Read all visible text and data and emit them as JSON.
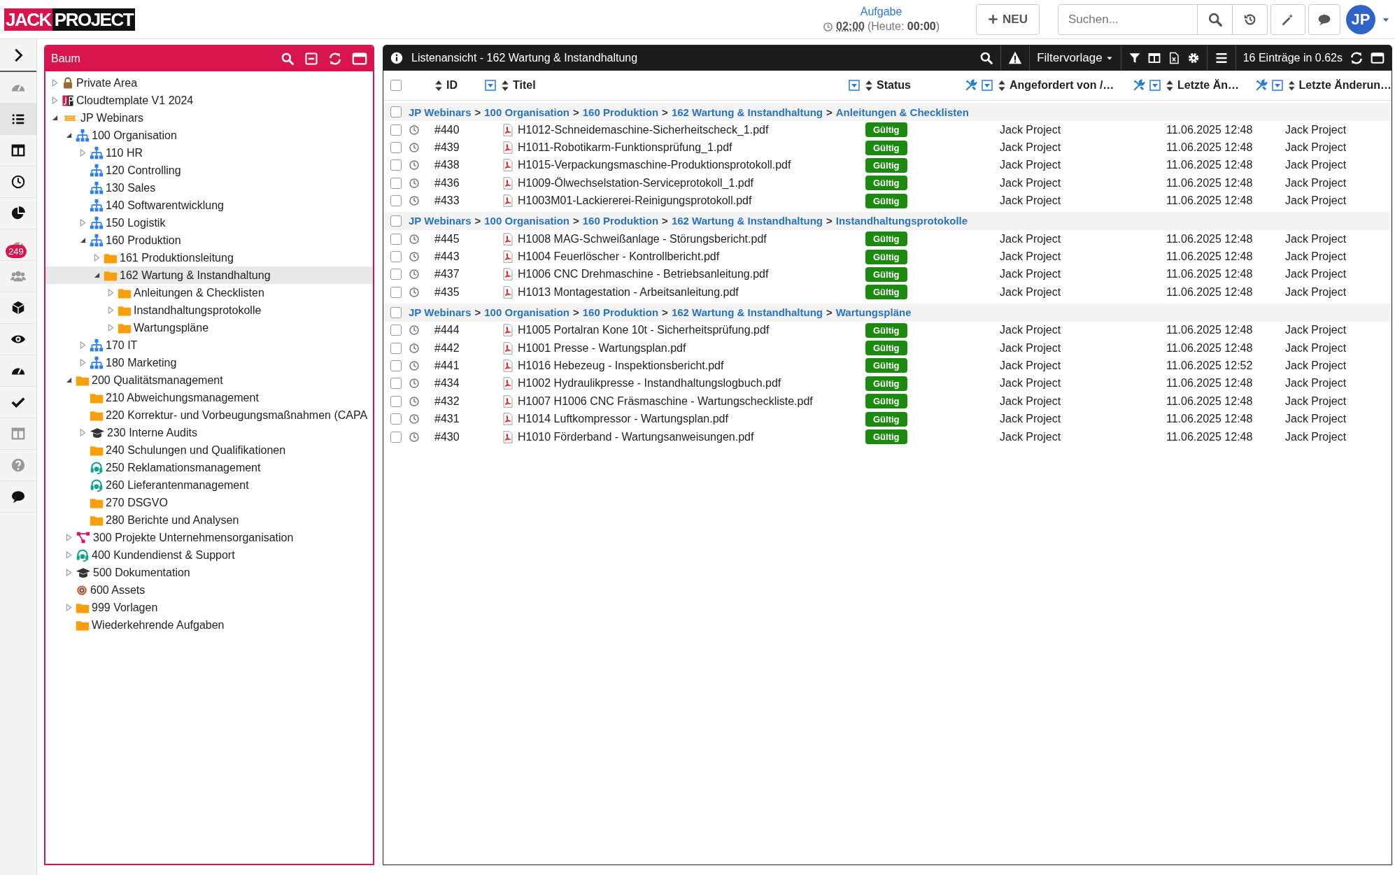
{
  "logo": [
    "JACK",
    "PROJECT"
  ],
  "task": {
    "label": "Aufgabe",
    "time": "02:00",
    "today": "(Heute: **00:00**)"
  },
  "topbar": {
    "new_button": "NEU",
    "search": {
      "placeholder": "Suchen..."
    },
    "avatar": "JP"
  },
  "rail": [
    {
      "kind": "expand",
      "selected": false,
      "dimmed": false
    },
    {
      "kind": "gauge",
      "selected": false,
      "dimmed": true
    },
    {
      "kind": "list",
      "selected": true,
      "dimmed": false
    },
    {
      "kind": "columns",
      "selected": false,
      "dimmed": false
    },
    {
      "kind": "clock",
      "selected": false,
      "dimmed": false
    },
    {
      "kind": "pie",
      "selected": false,
      "dimmed": false
    },
    {
      "kind": "gauge",
      "selected": false,
      "dimmed": true,
      "badge": "249"
    },
    {
      "kind": "users",
      "selected": false,
      "dimmed": true
    },
    {
      "kind": "cube",
      "selected": false,
      "dimmed": false
    },
    {
      "kind": "eye",
      "selected": false,
      "dimmed": false
    },
    {
      "kind": "gauge",
      "selected": false,
      "dimmed": false
    },
    {
      "kind": "check",
      "selected": false,
      "dimmed": false
    },
    {
      "kind": "columns",
      "selected": false,
      "dimmed": true
    },
    {
      "kind": "help",
      "selected": false,
      "dimmed": true
    },
    {
      "kind": "comment",
      "selected": false,
      "dimmed": false
    }
  ],
  "tree": {
    "title": "Baum",
    "items": [
      {
        "label": "Private Area",
        "kind": "lock",
        "expanded": false,
        "selected": false
      },
      {
        "label": "Cloudtemplate V1 2024",
        "kind": "jp",
        "expanded": false,
        "selected": false
      },
      {
        "label": "JP Webinars",
        "kind": "new",
        "expanded": true,
        "selected": false,
        "children": [
          {
            "label": "100 Organisation",
            "kind": "org",
            "expanded": true,
            "selected": false,
            "children": [
              {
                "label": "110 HR",
                "kind": "org",
                "expanded": false,
                "selected": false
              },
              {
                "label": "120 Controlling",
                "kind": "org",
                "selected": false
              },
              {
                "label": "130 Sales",
                "kind": "org",
                "selected": false
              },
              {
                "label": "140 Softwarentwicklung",
                "kind": "org",
                "selected": false
              },
              {
                "label": "150 Logistik",
                "kind": "org",
                "expanded": false,
                "selected": false
              },
              {
                "label": "160 Produktion",
                "kind": "org",
                "expanded": true,
                "selected": false,
                "children": [
                  {
                    "label": "161 Produktionsleitung",
                    "kind": "folder",
                    "expanded": false,
                    "selected": false
                  },
                  {
                    "label": "162 Wartung & Instandhaltung",
                    "kind": "folder",
                    "expanded": true,
                    "selected": true,
                    "children": [
                      {
                        "label": "Anleitungen & Checklisten",
                        "kind": "folder",
                        "expanded": false,
                        "selected": false
                      },
                      {
                        "label": "Instandhaltungsprotokolle",
                        "kind": "folder",
                        "expanded": false,
                        "selected": false
                      },
                      {
                        "label": "Wartungspläne",
                        "kind": "folder",
                        "expanded": false,
                        "selected": false
                      }
                    ]
                  }
                ]
              },
              {
                "label": "170 IT",
                "kind": "org",
                "expanded": false,
                "selected": false
              },
              {
                "label": "180 Marketing",
                "kind": "org",
                "expanded": false,
                "selected": false
              }
            ]
          },
          {
            "label": "200 Qualitätsmanagement",
            "kind": "folder",
            "expanded": true,
            "selected": false,
            "children": [
              {
                "label": "210 Abweichungsmanagement",
                "kind": "folder",
                "selected": false
              },
              {
                "label": "220 Korrektur- und Vorbeugungsmaßnahmen (CAPA",
                "kind": "folder",
                "selected": false
              },
              {
                "label": "230 Interne Audits",
                "kind": "cap",
                "expanded": false,
                "selected": false
              },
              {
                "label": "240 Schulungen und Qualifikationen",
                "kind": "folder",
                "selected": false
              },
              {
                "label": "250 Reklamationsmanagement",
                "kind": "headset",
                "selected": false
              },
              {
                "label": "260 Lieferantenmanagement",
                "kind": "headset",
                "selected": false
              },
              {
                "label": "270 DSGVO",
                "kind": "folder",
                "selected": false
              },
              {
                "label": "280 Berichte und Analysen",
                "kind": "folder",
                "selected": false
              }
            ]
          },
          {
            "label": "300 Projekte Unternehmensorganisation",
            "kind": "network",
            "expanded": false,
            "selected": false
          },
          {
            "label": "400 Kundendienst & Support",
            "kind": "headset",
            "expanded": false,
            "selected": false
          },
          {
            "label": "500 Dokumentation",
            "kind": "cap",
            "expanded": false,
            "selected": false
          },
          {
            "label": "600 Assets",
            "kind": "target",
            "selected": false
          },
          {
            "label": "999 Vorlagen",
            "kind": "folder",
            "expanded": false,
            "selected": false
          },
          {
            "label": "Wiederkehrende Aufgaben",
            "kind": "folder",
            "selected": false
          }
        ]
      }
    ]
  },
  "list": {
    "title": "Listenansicht - 162 Wartung & Instandhaltung",
    "filter_preset": "Filtervorlage",
    "summary": "16 Einträge in 0.62s",
    "header_checked": false,
    "columns": [
      {
        "label": "ID",
        "filter": true,
        "tools": false
      },
      {
        "label": "Titel",
        "filter": true,
        "tools": false
      },
      {
        "label": "Status",
        "filter": true,
        "tools": true
      },
      {
        "label": "Angefordert von /…",
        "filter": true,
        "tools": true
      },
      {
        "label": "Letzte Än…",
        "filter": true,
        "tools": true
      },
      {
        "label": "Letzte Änderun…",
        "filter": false,
        "tools": false
      }
    ],
    "breadcrumb_separator": ">",
    "groups": [
      {
        "checked": false,
        "path": [
          "JP Webinars",
          "100 Organisation",
          "160 Produktion",
          "162 Wartung & Instandhaltung",
          "Anleitungen & Checklisten"
        ],
        "rows": [
          {
            "checked": false,
            "id": "#440",
            "title": "H1012-Schneidemaschine-Sicherheitscheck_1.pdf",
            "status": "Gültig",
            "requested_by": "Jack Project",
            "modified": "11.06.2025 12:48",
            "modified_by": "Jack Project"
          },
          {
            "checked": false,
            "id": "#439",
            "title": "H1011-Robotikarm-Funktionsprüfung_1.pdf",
            "status": "Gültig",
            "requested_by": "Jack Project",
            "modified": "11.06.2025 12:48",
            "modified_by": "Jack Project"
          },
          {
            "checked": false,
            "id": "#438",
            "title": "H1015-Verpackungsmaschine-Produktionsprotokoll.pdf",
            "status": "Gültig",
            "requested_by": "Jack Project",
            "modified": "11.06.2025 12:48",
            "modified_by": "Jack Project"
          },
          {
            "checked": false,
            "id": "#436",
            "title": "H1009-Ölwechselstation-Serviceprotokoll_1.pdf",
            "status": "Gültig",
            "requested_by": "Jack Project",
            "modified": "11.06.2025 12:48",
            "modified_by": "Jack Project"
          },
          {
            "checked": false,
            "id": "#433",
            "title": "H1003M01-Lackiererei-Reinigungsprotokoll.pdf",
            "status": "Gültig",
            "requested_by": "Jack Project",
            "modified": "11.06.2025 12:48",
            "modified_by": "Jack Project"
          }
        ]
      },
      {
        "checked": false,
        "path": [
          "JP Webinars",
          "100 Organisation",
          "160 Produktion",
          "162 Wartung & Instandhaltung",
          "Instandhaltungsprotokolle"
        ],
        "rows": [
          {
            "checked": false,
            "id": "#445",
            "title": "H1008 MAG-Schweißanlage - Störungsbericht.pdf",
            "status": "Gültig",
            "requested_by": "Jack Project",
            "modified": "11.06.2025 12:48",
            "modified_by": "Jack Project"
          },
          {
            "checked": false,
            "id": "#443",
            "title": "H1004 Feuerlöscher - Kontrollbericht.pdf",
            "status": "Gültig",
            "requested_by": "Jack Project",
            "modified": "11.06.2025 12:48",
            "modified_by": "Jack Project"
          },
          {
            "checked": false,
            "id": "#437",
            "title": "H1006 CNC Drehmaschine - Betriebsanleitung.pdf",
            "status": "Gültig",
            "requested_by": "Jack Project",
            "modified": "11.06.2025 12:48",
            "modified_by": "Jack Project"
          },
          {
            "checked": false,
            "id": "#435",
            "title": "H1013 Montagestation - Arbeitsanleitung.pdf",
            "status": "Gültig",
            "requested_by": "Jack Project",
            "modified": "11.06.2025 12:48",
            "modified_by": "Jack Project"
          }
        ]
      },
      {
        "checked": false,
        "path": [
          "JP Webinars",
          "100 Organisation",
          "160 Produktion",
          "162 Wartung & Instandhaltung",
          "Wartungspläne"
        ],
        "rows": [
          {
            "checked": false,
            "id": "#444",
            "title": "H1005 Portalran Kone 10t - Sicherheitsprüfung.pdf",
            "status": "Gültig",
            "requested_by": "Jack Project",
            "modified": "11.06.2025 12:48",
            "modified_by": "Jack Project"
          },
          {
            "checked": false,
            "id": "#442",
            "title": "H1001 Presse - Wartungsplan.pdf",
            "status": "Gültig",
            "requested_by": "Jack Project",
            "modified": "11.06.2025 12:48",
            "modified_by": "Jack Project"
          },
          {
            "checked": false,
            "id": "#441",
            "title": "H1016 Hebezeug - Inspektionsbericht.pdf",
            "status": "Gültig",
            "requested_by": "Jack Project",
            "modified": "11.06.2025 12:52",
            "modified_by": "Jack Project"
          },
          {
            "checked": false,
            "id": "#434",
            "title": "H1002 Hydraulikpresse - Instandhaltungslogbuch.pdf",
            "status": "Gültig",
            "requested_by": "Jack Project",
            "modified": "11.06.2025 12:48",
            "modified_by": "Jack Project"
          },
          {
            "checked": false,
            "id": "#432",
            "title": "H1007 H1006 CNC Fräsmaschine - Wartungscheckliste.pdf",
            "status": "Gültig",
            "requested_by": "Jack Project",
            "modified": "11.06.2025 12:48",
            "modified_by": "Jack Project"
          },
          {
            "checked": false,
            "id": "#431",
            "title": "H1014 Luftkompressor - Wartungsplan.pdf",
            "status": "Gültig",
            "requested_by": "Jack Project",
            "modified": "11.06.2025 12:48",
            "modified_by": "Jack Project"
          },
          {
            "checked": false,
            "id": "#430",
            "title": "H1010 Förderband - Wartungsanweisungen.pdf",
            "status": "Gültig",
            "requested_by": "Jack Project",
            "modified": "11.06.2025 12:48",
            "modified_by": "Jack Project"
          }
        ]
      }
    ]
  }
}
